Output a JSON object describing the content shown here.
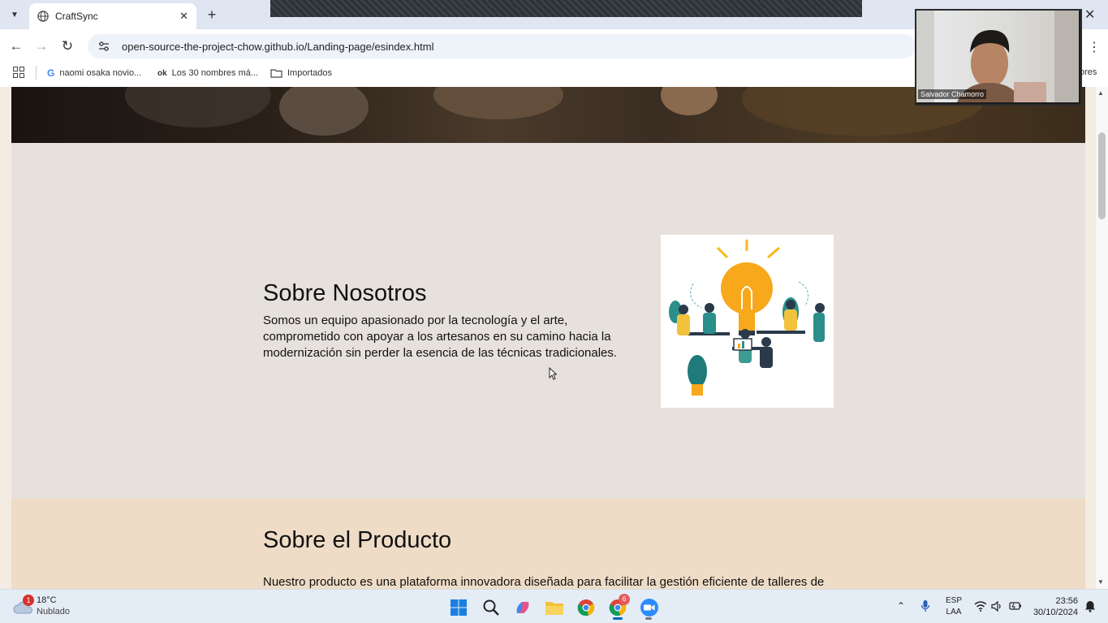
{
  "browser": {
    "tab_title": "CraftSync",
    "url": "open-source-the-project-chow.github.io/Landing-page/esindex.html",
    "bookmarks": [
      {
        "label": "naomi osaka novio...",
        "icon": "google-icon"
      },
      {
        "label": "Los 30 nombres má...",
        "icon": "ok-icon"
      },
      {
        "label": "Importados",
        "icon": "folder-icon"
      }
    ],
    "bookmarks_overflow_label": "ores"
  },
  "page": {
    "about": {
      "title": "Sobre Nosotros",
      "text": "Somos un equipo apasionado por la tecnología y el arte, comprometido con apoyar a los artesanos en su camino hacia la modernización sin perder la esencia de las técnicas tradicionales.",
      "image_subject": "team-lightbulb-illustration"
    },
    "product": {
      "title": "Sobre el Producto",
      "text": "Nuestro producto es una plataforma innovadora diseñada para facilitar la gestión eficiente de talleres de"
    }
  },
  "video": {
    "participant_name": "Salvador Chamorro"
  },
  "taskbar": {
    "weather": {
      "badge": "1",
      "temp": "18°C",
      "condition": "Nublado"
    },
    "chrome_badge": "6",
    "lang_line1": "ESP",
    "lang_line2": "LAA",
    "time": "23:56",
    "date": "30/10/2024"
  },
  "colors": {
    "about_bg": "#e6e1dc",
    "product_bg": "#efdcc6",
    "tab_strip": "#dfe6f2",
    "taskbar": "#e4ecf6",
    "accent": "#0067c0"
  }
}
